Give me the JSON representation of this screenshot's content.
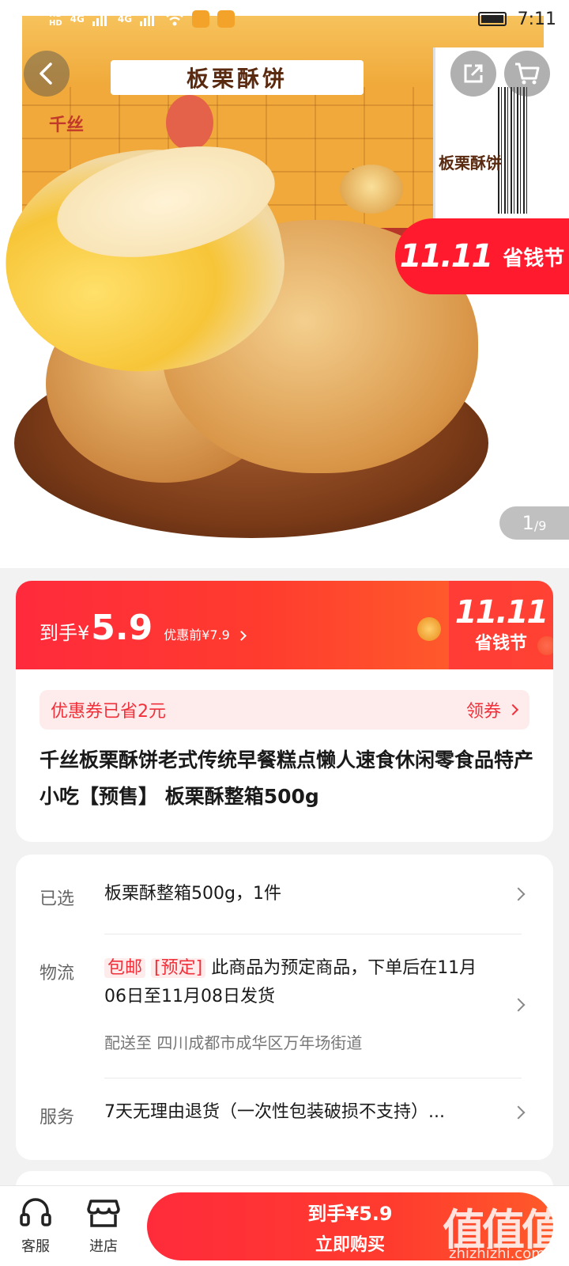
{
  "status_bar": {
    "hd1": "HD",
    "hd2": "HD",
    "net1": "4G",
    "net2": "4G",
    "time": "7:11"
  },
  "hero": {
    "box_label": "板栗酥饼",
    "box_brand": "千丝",
    "box_title": "板 饼",
    "box_side": "板栗酥饼",
    "promo_1111": "11.11",
    "promo_text": "省钱节",
    "pager_current": "1",
    "pager_total": "/9"
  },
  "price": {
    "prefix": "到手¥",
    "value": "5.9",
    "original": "优惠前¥7.9",
    "fest_1111": "11.11",
    "fest_text": "省钱节"
  },
  "coupon": {
    "text": "优惠券已省2元",
    "action": "领券"
  },
  "product": {
    "title": "千丝板栗酥饼老式传统早餐糕点懒人速食休闲零食品特产小吃【预售】 板栗酥整箱500g"
  },
  "spec": {
    "selected_label": "已选",
    "selected_value": "板栗酥整箱500g，1件",
    "logistics_label": "物流",
    "tag_free": "包邮",
    "tag_presale": "[预定]",
    "logistics_value": "此商品为预定商品，下单后在11月06日至11月08日发货",
    "address": "配送至  四川成都市成华区万年场街道",
    "service_label": "服务",
    "service_value": "7天无理由退货（一次性包装破损不支持）..."
  },
  "bottom_bar": {
    "service_label": "客服",
    "store_label": "进店",
    "buy_price": "到手¥5.9",
    "buy_label": "立即购买"
  },
  "watermark": {
    "main": "值值值",
    "sub": "zhizhizhi.com"
  },
  "colors": {
    "accent": "#ff2a3c",
    "accent_orange": "#ff6a2a",
    "coupon_bg": "#fdeceb"
  }
}
